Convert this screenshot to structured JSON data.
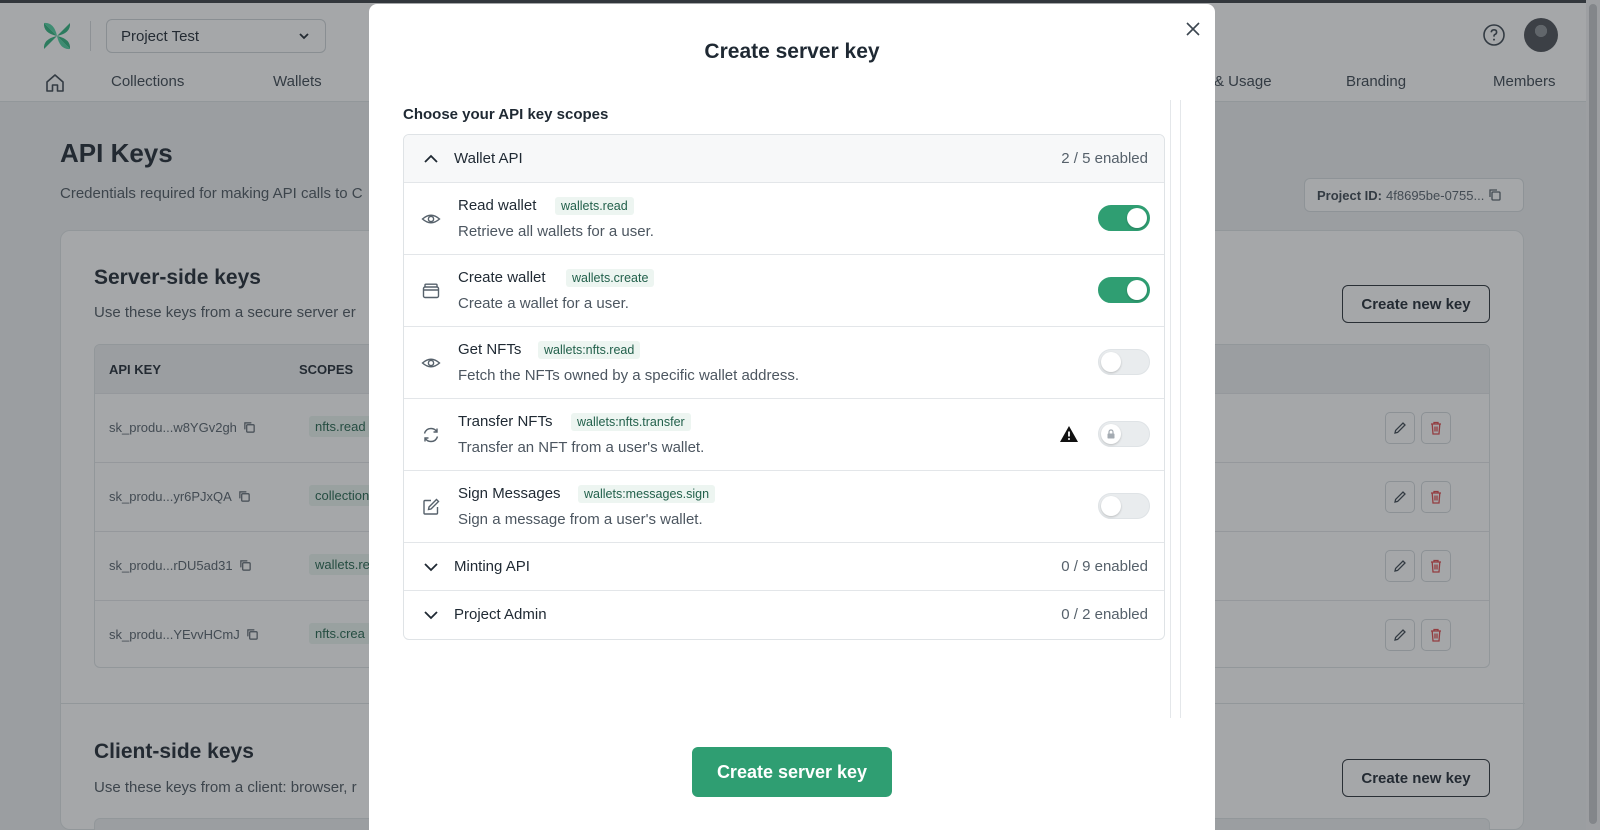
{
  "header": {
    "project_name": "Project Test"
  },
  "nav": {
    "items": [
      "Collections",
      "Wallets",
      "& Usage",
      "Branding",
      "Members"
    ]
  },
  "page": {
    "title": "API Keys",
    "subtitle": "Credentials required for making API calls to C",
    "project_id_label": "Project ID:",
    "project_id_value": "4f8695be-0755..."
  },
  "server_keys": {
    "title": "Server-side keys",
    "subtitle": "Use these keys from a secure server er",
    "create_button": "Create new key",
    "columns": [
      "API KEY",
      "SCOPES"
    ],
    "rows": [
      {
        "key": "sk_produ...w8YGv2gh",
        "scope": "nfts.read"
      },
      {
        "key": "sk_produ...yr6PJxQA",
        "scope": "collection"
      },
      {
        "key": "sk_produ...rDU5ad31",
        "scope": "wallets.re"
      },
      {
        "key": "sk_produ...YEvvHCmJ",
        "scope": "nfts.crea"
      }
    ]
  },
  "client_keys": {
    "title": "Client-side keys",
    "subtitle": "Use these keys from a client: browser, r",
    "create_button": "Create new key"
  },
  "modal": {
    "title": "Create server key",
    "scopes_heading": "Choose your API key scopes",
    "submit_button": "Create server key",
    "groups": [
      {
        "name": "Wallet API",
        "count": "2 / 5 enabled",
        "expanded": true,
        "scopes": [
          {
            "name": "Read wallet",
            "code": "wallets.read",
            "description": "Retrieve all wallets for a user.",
            "icon": "eye-icon",
            "enabled": true,
            "locked": false
          },
          {
            "name": "Create wallet",
            "code": "wallets.create",
            "description": "Create a wallet for a user.",
            "icon": "wallet-icon",
            "enabled": true,
            "locked": false
          },
          {
            "name": "Get NFTs",
            "code": "wallets:nfts.read",
            "description": "Fetch the NFTs owned by a specific wallet address.",
            "icon": "eye-icon",
            "enabled": false,
            "locked": false
          },
          {
            "name": "Transfer NFTs",
            "code": "wallets:nfts.transfer",
            "description": "Transfer an NFT from a user's wallet.",
            "icon": "refresh-icon",
            "enabled": false,
            "locked": true
          },
          {
            "name": "Sign Messages",
            "code": "wallets:messages.sign",
            "description": "Sign a message from a user's wallet.",
            "icon": "pen-icon",
            "enabled": false,
            "locked": false
          }
        ]
      },
      {
        "name": "Minting API",
        "count": "0 / 9 enabled",
        "expanded": false
      },
      {
        "name": "Project Admin",
        "count": "0 / 2 enabled",
        "expanded": false
      }
    ]
  },
  "colors": {
    "accent": "#2f9e72",
    "danger": "#e0484a"
  }
}
